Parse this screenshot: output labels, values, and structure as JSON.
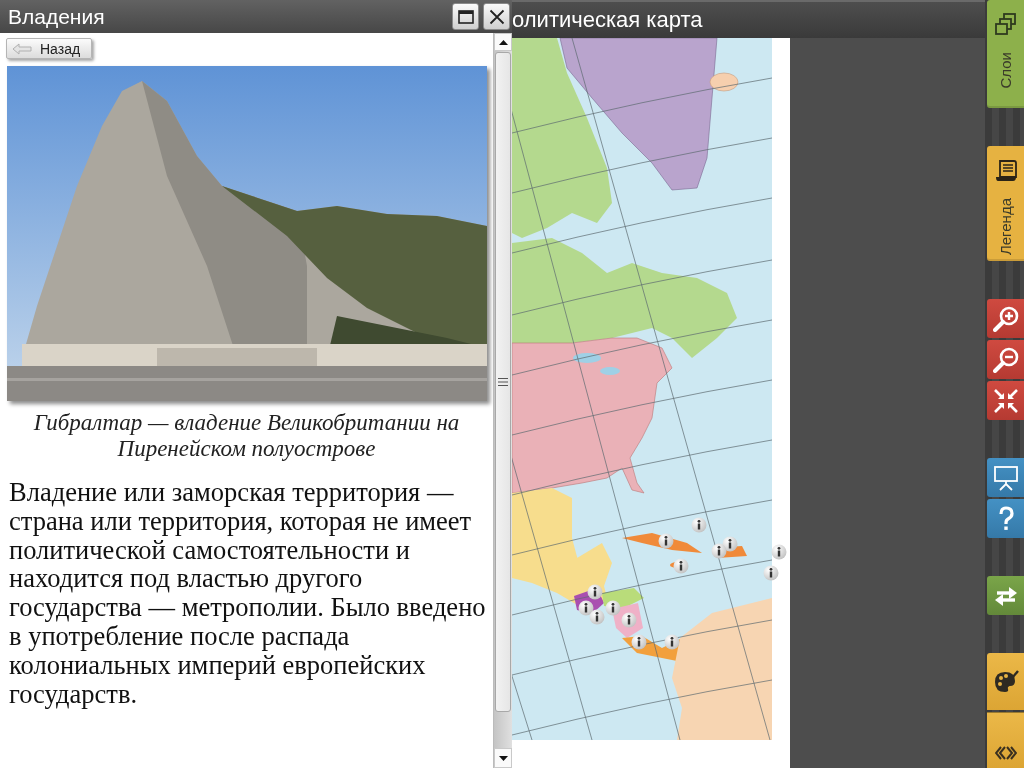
{
  "map_window": {
    "title": "олитическая карта"
  },
  "side_panel": {
    "title": "Владения",
    "back_button": "Назад",
    "photo_caption": "Гибралтар — владение Великобритании на Пиренейском полуострове",
    "description": "Владение или заморская территория — страна или территория, которая не имеет политической самостоятельности и находится под властью другого государства — метрополии. Было введено в употребление после распада колониальных империй европейских государств."
  },
  "toolbar": {
    "tabs": [
      {
        "label": "Слои",
        "color": "#8db04b"
      },
      {
        "label": "Легенда",
        "color": "#e6b241"
      }
    ]
  }
}
